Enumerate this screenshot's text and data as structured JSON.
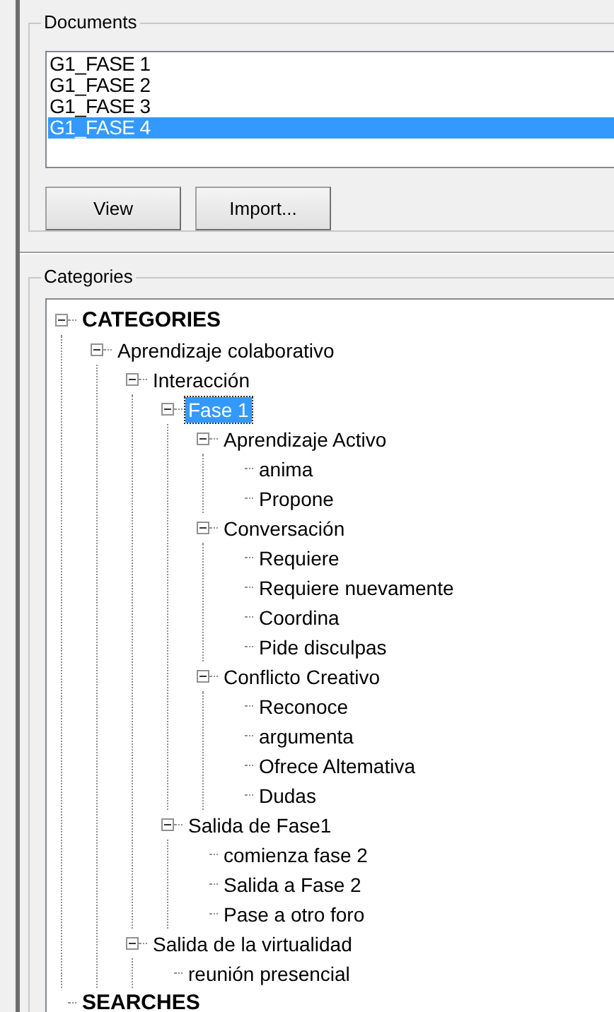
{
  "documents": {
    "title": "Documents",
    "items": [
      {
        "label": "G1_FASE 1",
        "selected": false
      },
      {
        "label": "G1_FASE 2",
        "selected": false
      },
      {
        "label": "G1_FASE 3",
        "selected": false
      },
      {
        "label": "G1_FASE 4",
        "selected": true
      }
    ],
    "buttons": [
      "View",
      "Import..."
    ]
  },
  "categories": {
    "title": "Categories",
    "tree": [
      {
        "label": "CATEGORIES",
        "kind": "root",
        "expanded": true,
        "selected": false,
        "children": [
          {
            "label": "Aprendizaje colaborativo",
            "expanded": true,
            "selected": false,
            "children": [
              {
                "label": "Interacción",
                "expanded": true,
                "selected": false,
                "children": [
                  {
                    "label": "Fase 1",
                    "expanded": true,
                    "selected": true,
                    "children": [
                      {
                        "label": "Aprendizaje Activo",
                        "expanded": true,
                        "selected": false,
                        "children": [
                          {
                            "label": "anima",
                            "selected": false
                          },
                          {
                            "label": "Propone",
                            "selected": false
                          }
                        ]
                      },
                      {
                        "label": "Conversación",
                        "expanded": true,
                        "selected": false,
                        "children": [
                          {
                            "label": "Requiere",
                            "selected": false
                          },
                          {
                            "label": "Requiere nuevamente",
                            "selected": false
                          },
                          {
                            "label": "Coordina",
                            "selected": false
                          },
                          {
                            "label": "Pide disculpas",
                            "selected": false
                          }
                        ]
                      },
                      {
                        "label": "Conflicto Creativo",
                        "expanded": true,
                        "selected": false,
                        "children": [
                          {
                            "label": "Reconoce",
                            "selected": false
                          },
                          {
                            "label": "argumenta",
                            "selected": false
                          },
                          {
                            "label": "Ofrece Altemativa",
                            "selected": false
                          },
                          {
                            "label": "Dudas",
                            "selected": false
                          }
                        ]
                      }
                    ]
                  },
                  {
                    "label": "Salida de Fase1",
                    "expanded": true,
                    "selected": false,
                    "children": [
                      {
                        "label": "comienza fase 2",
                        "selected": false
                      },
                      {
                        "label": "Salida a Fase 2",
                        "selected": false
                      },
                      {
                        "label": "Pase a otro foro",
                        "selected": false
                      }
                    ]
                  }
                ]
              },
              {
                "label": "Salida de la virtualidad",
                "expanded": true,
                "selected": false,
                "children": [
                  {
                    "label": "reunión presencial",
                    "selected": false
                  }
                ]
              }
            ]
          }
        ]
      },
      {
        "label": "SEARCHES",
        "kind": "root",
        "selected": false
      }
    ]
  }
}
